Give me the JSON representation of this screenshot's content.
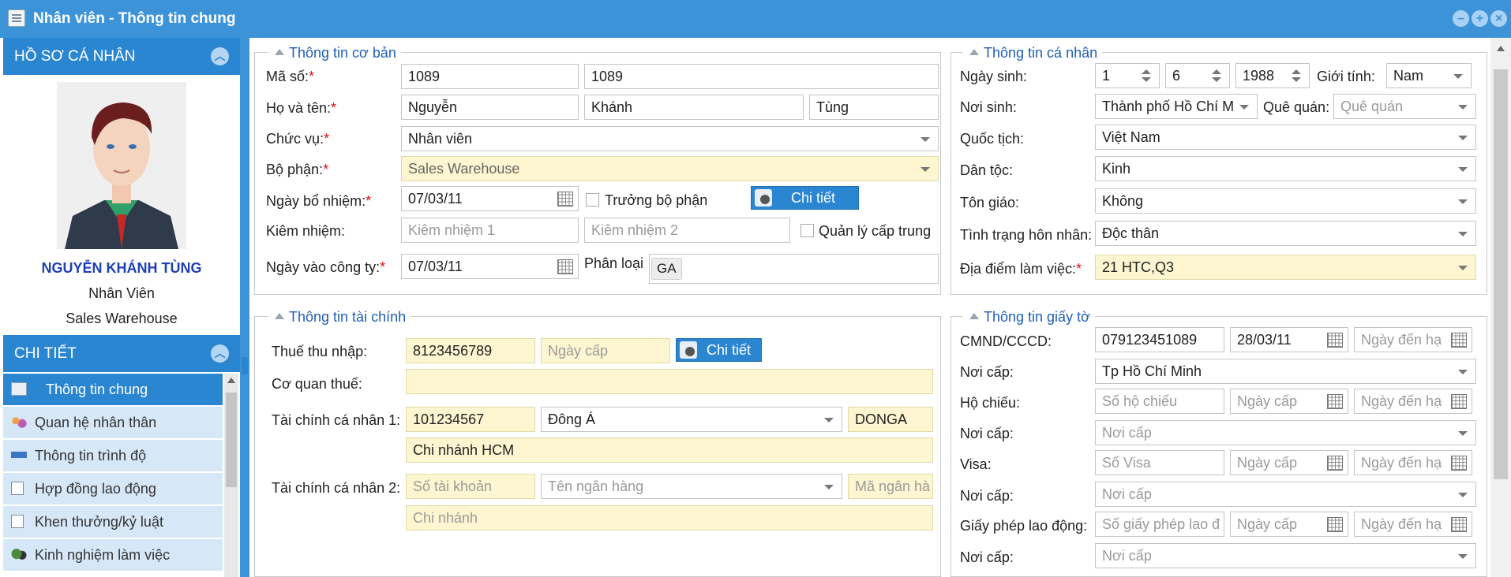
{
  "window": {
    "title": "Nhân viên - Thông tin chung"
  },
  "sidebar": {
    "profile_header": "HỒ SƠ CÁ NHÂN",
    "employee_name": "NGUYỄN KHÁNH TÙNG",
    "employee_position": "Nhân Viên",
    "employee_department": "Sales Warehouse",
    "detail_header": "CHI TIẾT",
    "menu": [
      {
        "label": "Thông tin chung",
        "icon": "id-card-icon"
      },
      {
        "label": "Quan hệ nhân thân",
        "icon": "family-icon"
      },
      {
        "label": "Thông tin trình độ",
        "icon": "education-icon"
      },
      {
        "label": "Hợp đồng lao động",
        "icon": "contract-icon"
      },
      {
        "label": "Khen thưởng/kỷ luật",
        "icon": "reward-icon"
      },
      {
        "label": "Kinh nghiệm làm việc",
        "icon": "experience-icon"
      }
    ]
  },
  "basic": {
    "title": "Thông tin cơ bản",
    "ma_so_label": "Mã số:",
    "ma_so_1": "1089",
    "ma_so_2": "1089",
    "ho_ten_label": "Họ và tên:",
    "ho": "Nguyễn",
    "dem": "Khánh",
    "ten": "Tùng",
    "chuc_vu_label": "Chức vụ:",
    "chuc_vu": "Nhân viên",
    "bo_phan_label": "Bộ phận:",
    "bo_phan": "Sales Warehouse",
    "ngay_bo_nhiem_label": "Ngày bổ nhiệm:",
    "ngay_bo_nhiem": "07/03/11",
    "truong_bo_phan_label": "Trưởng bộ phận",
    "chi_tiet_label": "Chi tiết",
    "kiem_nhiem_label": "Kiêm nhiệm:",
    "kiem_nhiem_1_ph": "Kiêm nhiệm 1",
    "kiem_nhiem_2_ph": "Kiêm nhiệm 2",
    "quan_ly_label": "Quản lý cấp trung",
    "ngay_vao_label": "Ngày vào công ty:",
    "ngay_vao": "07/03/11",
    "phan_loai_label": "Phân loại",
    "phan_loai_tag": "GA"
  },
  "personal": {
    "title": "Thông tin cá nhân",
    "ngay_sinh_label": "Ngày sinh:",
    "day": "1",
    "month": "6",
    "year": "1988",
    "gioi_tinh_label": "Giới tính:",
    "gioi_tinh": "Nam",
    "noi_sinh_label": "Nơi sinh:",
    "noi_sinh": "Thành phố Hồ Chí M",
    "que_quan_label": "Quê quán:",
    "que_quan_ph": "Quê quán",
    "quoc_tich_label": "Quốc tịch:",
    "quoc_tich": "Việt Nam",
    "dan_toc_label": "Dân tộc:",
    "dan_toc": "Kinh",
    "ton_giao_label": "Tôn giáo:",
    "ton_giao": "Không",
    "hon_nhan_label": "Tình trạng hôn nhân:",
    "hon_nhan": "Độc thân",
    "dia_diem_label": "Địa điểm làm việc:",
    "dia_diem": "21 HTC,Q3"
  },
  "finance": {
    "title": "Thông tin tài chính",
    "thue_label": "Thuế thu nhập:",
    "thue": "8123456789",
    "ngay_cap_ph": "Ngày cấp",
    "chi_tiet_label": "Chi tiết",
    "co_quan_label": "Cơ quan thuế:",
    "tc1_label": "Tài chính cá nhân 1:",
    "tc1_account": "101234567",
    "tc1_bank": "Đông Á",
    "tc1_code": "DONGA",
    "tc1_branch": "Chi nhánh HCM",
    "tc2_label": "Tài chính cá nhân 2:",
    "tc2_account_ph": "Số tài khoản",
    "tc2_bank_ph": "Tên ngân hàng",
    "tc2_code_ph": "Mã ngân hà",
    "tc2_branch_ph": "Chi nhánh"
  },
  "docs": {
    "title": "Thông tin giấy tờ",
    "cmnd_label": "CMND/CCCD:",
    "cmnd": "079123451089",
    "cmnd_date": "28/03/11",
    "den_han_ph": "Ngày đến hạ",
    "noi_cap_label": "Nơi cấp:",
    "cmnd_noi_cap": "Tp Hồ Chí Minh",
    "ho_chieu_label": "Hộ chiếu:",
    "ho_chieu_ph": "Số hộ chiếu",
    "ngay_cap_ph": "Ngày cấp",
    "noi_cap_ph": "Nơi cấp",
    "visa_label": "Visa:",
    "visa_ph": "Số Visa",
    "gplđ_label": "Giấy phép lao động:",
    "gplđ_ph": "Số giấy phép lao đ"
  }
}
